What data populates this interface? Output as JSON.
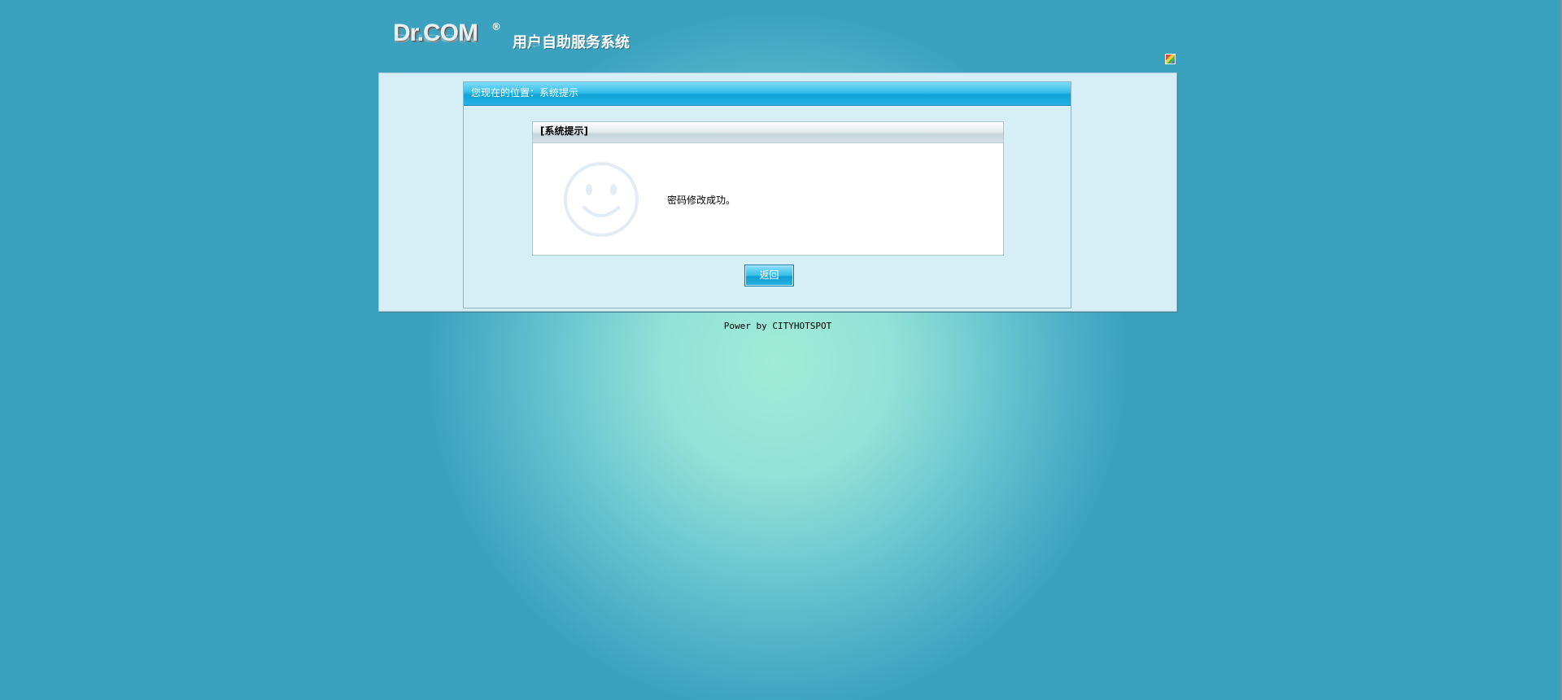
{
  "header": {
    "logo_text": "Dr.COM",
    "registered_mark": "®",
    "system_title": "用户自助服务系统"
  },
  "icons": {
    "skin_switch": "skin-icon",
    "smiley": "smiley-face-icon"
  },
  "location_bar": {
    "text": "您现在的位置：系统提示"
  },
  "message_box": {
    "title": "[系统提示]",
    "message": "密码修改成功。"
  },
  "actions": {
    "back_label": "返回"
  },
  "footer": {
    "text": "Power by CITYHOTSPOT"
  },
  "colors": {
    "background": "#3aa2bf",
    "glow": "#a0ecd4",
    "panel": "#d6eef6",
    "title_bar": "#10a2d6"
  }
}
